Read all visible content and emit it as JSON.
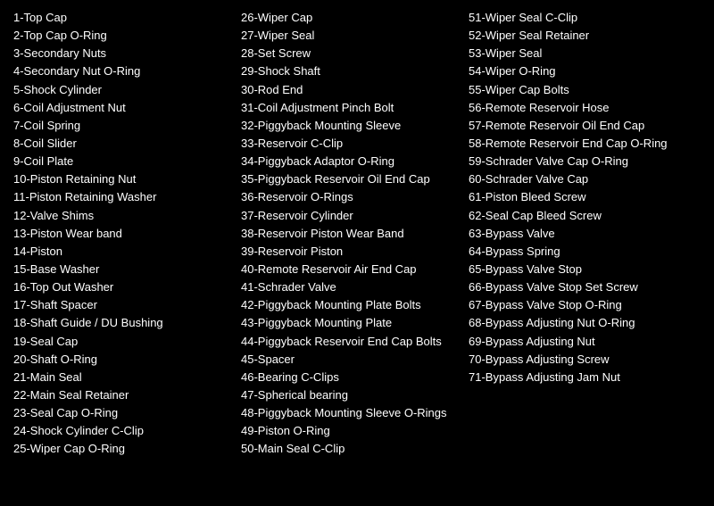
{
  "col1": {
    "items": [
      "1-Top Cap",
      "2-Top Cap O-Ring",
      "3-Secondary Nuts",
      "4-Secondary Nut O-Ring",
      "5-Shock Cylinder",
      "6-Coil Adjustment Nut",
      "7-Coil Spring",
      "8-Coil Slider",
      "9-Coil Plate",
      "10-Piston Retaining Nut",
      "11-Piston Retaining Washer",
      "12-Valve Shims",
      "13-Piston Wear band",
      "14-Piston",
      "15-Base Washer",
      "16-Top Out Washer",
      "17-Shaft Spacer",
      "18-Shaft Guide / DU Bushing",
      "19-Seal Cap",
      "20-Shaft O-Ring",
      "21-Main Seal",
      "22-Main Seal Retainer",
      "23-Seal Cap O-Ring",
      "24-Shock Cylinder C-Clip",
      "25-Wiper Cap O-Ring"
    ]
  },
  "col2": {
    "items": [
      "26-Wiper Cap",
      "27-Wiper Seal",
      "28-Set Screw",
      "29-Shock Shaft",
      "30-Rod End",
      "31-Coil Adjustment Pinch Bolt",
      "32-Piggyback Mounting Sleeve",
      "33-Reservoir C-Clip",
      "34-Piggyback Adaptor O-Ring",
      "35-Piggyback Reservoir Oil End Cap",
      "36-Reservoir O-Rings",
      "37-Reservoir Cylinder",
      "38-Reservoir Piston Wear Band",
      "39-Reservoir Piston",
      "40-Remote Reservoir Air End Cap",
      "41-Schrader Valve",
      "42-Piggyback Mounting Plate Bolts",
      "43-Piggyback Mounting Plate",
      "44-Piggyback Reservoir End Cap Bolts",
      "45-Spacer",
      "46-Bearing C-Clips",
      "47-Spherical bearing",
      "48-Piggyback Mounting Sleeve O-Rings",
      "49-Piston O-Ring",
      "50-Main Seal C-Clip"
    ]
  },
  "col3": {
    "items": [
      "51-Wiper Seal C-Clip",
      "52-Wiper Seal Retainer",
      "53-Wiper Seal",
      "54-Wiper O-Ring",
      "55-Wiper Cap Bolts",
      "56-Remote Reservoir Hose",
      "57-Remote Reservoir Oil End Cap",
      "58-Remote Reservoir End Cap O-Ring",
      "59-Schrader Valve Cap O-Ring",
      "60-Schrader Valve Cap",
      "61-Piston Bleed Screw",
      "62-Seal Cap Bleed Screw",
      "63-Bypass Valve",
      "64-Bypass Spring",
      "65-Bypass Valve Stop",
      "66-Bypass Valve Stop Set Screw",
      "67-Bypass Valve Stop O-Ring",
      "68-Bypass Adjusting Nut O-Ring",
      "69-Bypass Adjusting Nut",
      "70-Bypass Adjusting Screw",
      "71-Bypass Adjusting Jam Nut"
    ]
  }
}
